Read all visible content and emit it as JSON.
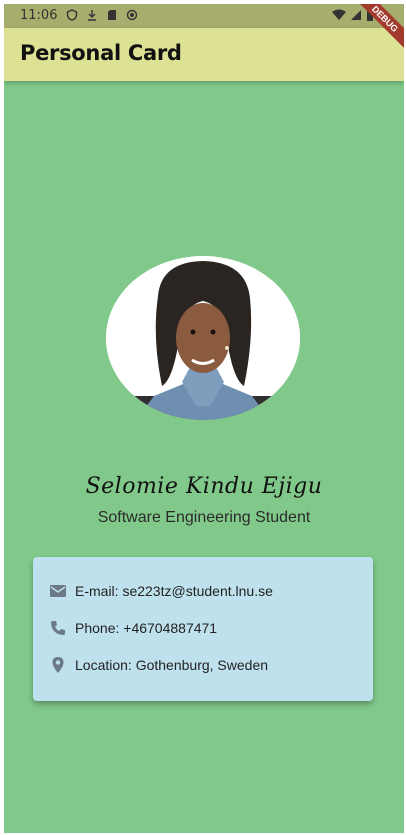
{
  "status_bar": {
    "time": "11:06",
    "icons": [
      "shield-icon",
      "download-icon",
      "sd-card-icon",
      "record-icon",
      "wifi-icon",
      "signal-icon",
      "battery-icon"
    ]
  },
  "app_bar": {
    "title": "Personal Card",
    "color": "#dde193"
  },
  "debug_banner": {
    "label": "DEBUG"
  },
  "profile": {
    "name": "Selomie Kindu Ejigu",
    "subtitle": "Software Engineering Student"
  },
  "contact": {
    "email": "E-mail: se223tz@student.lnu.se",
    "phone": "Phone: +46704887471",
    "location": "Location: Gothenburg, Sweden",
    "icons": [
      "email-icon",
      "phone-icon",
      "location-icon"
    ]
  },
  "colors": {
    "background": "#81c98a",
    "card": "#bfe1ee",
    "icon": "#6b7a86"
  }
}
